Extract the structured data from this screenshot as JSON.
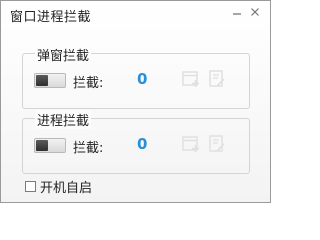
{
  "window": {
    "title": "窗口进程拦截",
    "minimize_icon": "minimize-icon",
    "close_icon": "close-icon"
  },
  "popup_group": {
    "legend": "弹窗拦截",
    "toggle_on": false,
    "count_label": "拦截:",
    "count_value": "0",
    "icons": [
      "add-rule-icon",
      "edit-list-icon"
    ]
  },
  "process_group": {
    "legend": "进程拦截",
    "toggle_on": false,
    "count_label": "拦截:",
    "count_value": "0",
    "icons": [
      "add-rule-icon",
      "edit-list-icon"
    ]
  },
  "autostart": {
    "label": "开机自启",
    "checked": false
  },
  "colors": {
    "count_value": "#2b8fd8",
    "icon_faded": "#e0e0e0"
  }
}
